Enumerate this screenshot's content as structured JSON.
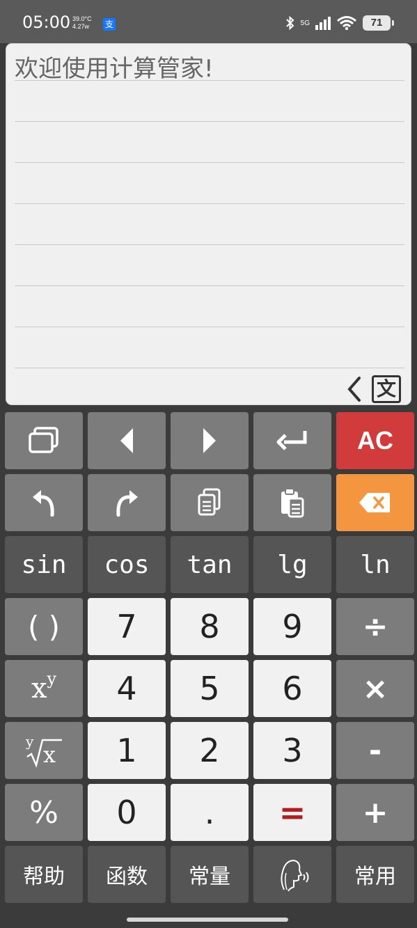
{
  "status_bar": {
    "time": "05:00",
    "temp": "39.0°C",
    "power": "4.27w",
    "network": "5G",
    "wifi_level": "6",
    "battery": "71"
  },
  "display": {
    "welcome": "欢迎使用计算管家!",
    "lang_icon_label": "文"
  },
  "keys": {
    "ac": "AC",
    "sin": "sin",
    "cos": "cos",
    "tan": "tan",
    "lg": "lg",
    "ln": "ln",
    "paren": "( )",
    "n7": "7",
    "n8": "8",
    "n9": "9",
    "divide": "÷",
    "pow_base": "x",
    "pow_exp": "y",
    "n4": "4",
    "n5": "5",
    "n6": "6",
    "multiply": "×",
    "root_index": "y",
    "root_base": "x",
    "n1": "1",
    "n2": "2",
    "n3": "3",
    "minus": "-",
    "percent": "%",
    "n0": "0",
    "dot": ".",
    "equals": "=",
    "plus": "+",
    "help": "帮助",
    "function": "函数",
    "constant": "常量",
    "common": "常用"
  },
  "colors": {
    "ac_red": "#d13b3b",
    "backspace_orange": "#f4963f",
    "equals_red": "#b21e1e"
  }
}
